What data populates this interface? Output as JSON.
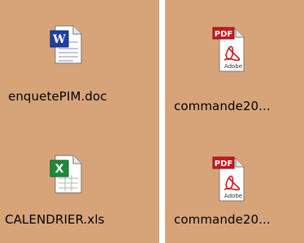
{
  "desktop": {
    "left_pane": {
      "files": [
        {
          "name": "enquetePIM.doc",
          "icon": "word-document-icon",
          "badge": "W"
        },
        {
          "name": "CALENDRIER.xls",
          "icon": "excel-spreadsheet-icon",
          "badge": "X"
        }
      ]
    },
    "right_pane": {
      "files": [
        {
          "name": "commande20...",
          "icon": "pdf-document-icon",
          "badge": "PDF",
          "sublabel": "Adobe"
        },
        {
          "name": "commande20...",
          "icon": "pdf-document-icon",
          "badge": "PDF",
          "sublabel": "Adobe"
        }
      ]
    }
  },
  "colors": {
    "desktop_background": "#d7a47a",
    "divider": "#ffffff",
    "word_blue": "#1f3fa8",
    "excel_green": "#1e8a3a",
    "pdf_red": "#c8191e"
  }
}
